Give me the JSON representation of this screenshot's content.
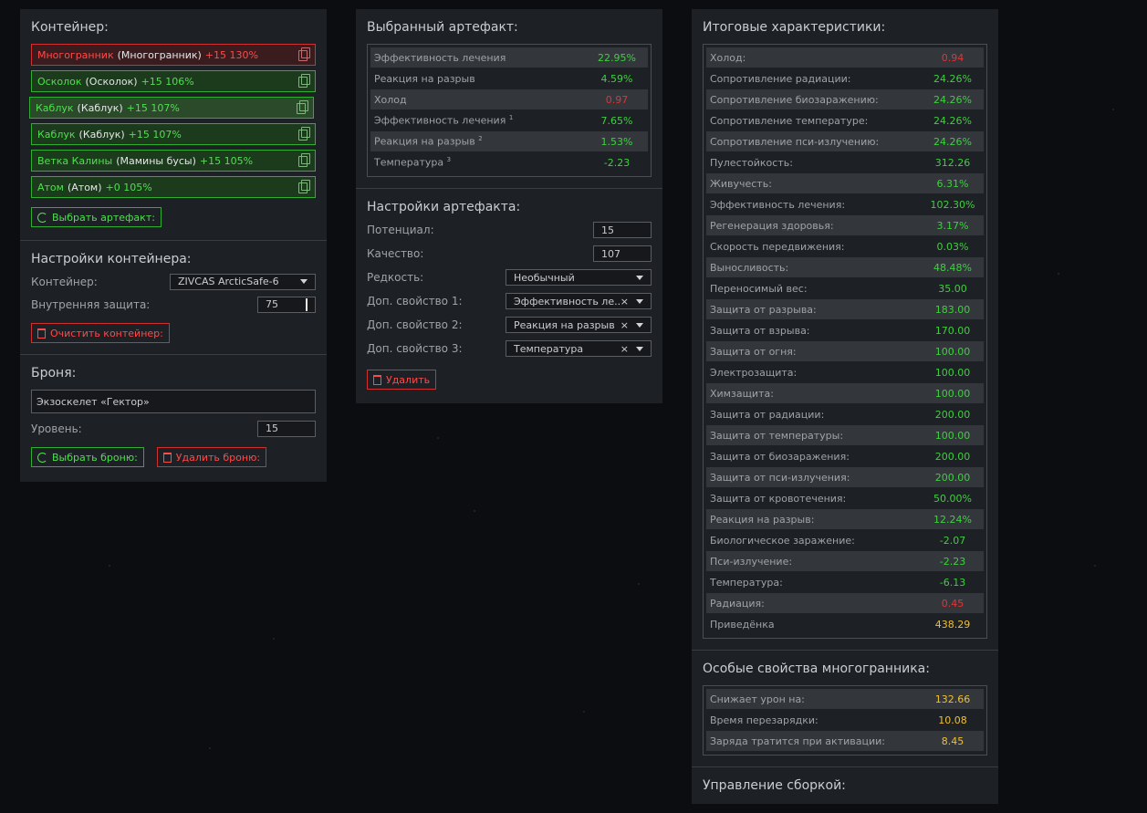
{
  "container_panel": {
    "title": "Контейнер:",
    "slots": [
      {
        "name": "Многогранник",
        "orig": "(Многогранник)",
        "level": "+15 130%",
        "status": "bad"
      },
      {
        "name": "Осколок",
        "orig": "(Осколок)",
        "level": "+15 106%",
        "status": "ok"
      },
      {
        "name": "Каблук",
        "orig": "(Каблук)",
        "level": "+15 107%",
        "status": "selected"
      },
      {
        "name": "Каблук",
        "orig": "(Каблук)",
        "level": "+15 107%",
        "status": "ok"
      },
      {
        "name": "Ветка Калины",
        "orig": "(Мамины бусы)",
        "level": "+15 105%",
        "status": "ok"
      },
      {
        "name": "Атом",
        "orig": "(Атом)",
        "level": "+0 105%",
        "status": "ok"
      }
    ],
    "select_button": "Выбрать артефакт:"
  },
  "container_settings": {
    "title": "Настройки контейнера:",
    "container_label": "Контейнер:",
    "container_value": "ZIVCAS ArcticSafe-6",
    "protection_label": "Внутренняя защита:",
    "protection_value": "75",
    "clear_button": "Очистить контейнер:"
  },
  "armor": {
    "title": "Броня:",
    "armor_value": "Экзоскелет «Гектор»",
    "level_label": "Уровень:",
    "level_value": "15",
    "select_button": "Выбрать броню:",
    "delete_button": "Удалить броню:"
  },
  "selected_artifact": {
    "title": "Выбранный артефакт:",
    "rows": [
      {
        "k": "Эффективность лечения",
        "sup": "",
        "v": "22.95%",
        "c": "g"
      },
      {
        "k": "Реакция на разрыв",
        "sup": "",
        "v": "4.59%",
        "c": "g"
      },
      {
        "k": "Холод",
        "sup": "",
        "v": "0.97",
        "c": "r"
      },
      {
        "k": "Эффективность лечения",
        "sup": "1",
        "v": "7.65%",
        "c": "g"
      },
      {
        "k": "Реакция на разрыв",
        "sup": "2",
        "v": "1.53%",
        "c": "g"
      },
      {
        "k": "Температура",
        "sup": "3",
        "v": "-2.23",
        "c": "g"
      }
    ]
  },
  "artifact_settings": {
    "title": "Настройки артефакта:",
    "potential_label": "Потенциал:",
    "potential_value": "15",
    "quality_label": "Качество:",
    "quality_value": "107",
    "rarity_label": "Редкость:",
    "rarity_value": "Необычный",
    "extra1_label": "Доп. свойство 1:",
    "extra1_value": "Эффективность ле...",
    "extra2_label": "Доп. свойство 2:",
    "extra2_value": "Реакция на разрыв",
    "extra3_label": "Доп. свойство 3:",
    "extra3_value": "Температура",
    "delete_button": "Удалить"
  },
  "totals": {
    "title": "Итоговые характеристики:",
    "rows": [
      {
        "k": "Холод:",
        "v": "0.94",
        "c": "r"
      },
      {
        "k": "Сопротивление радиации:",
        "v": "24.26%",
        "c": "g"
      },
      {
        "k": "Сопротивление биозаражению:",
        "v": "24.26%",
        "c": "g"
      },
      {
        "k": "Сопротивление температуре:",
        "v": "24.26%",
        "c": "g"
      },
      {
        "k": "Сопротивление пси-излучению:",
        "v": "24.26%",
        "c": "g"
      },
      {
        "k": "Пулестойкость:",
        "v": "312.26",
        "c": "g"
      },
      {
        "k": "Живучесть:",
        "v": "6.31%",
        "c": "g"
      },
      {
        "k": "Эффективность лечения:",
        "v": "102.30%",
        "c": "g"
      },
      {
        "k": "Регенерация здоровья:",
        "v": "3.17%",
        "c": "g"
      },
      {
        "k": "Скорость передвижения:",
        "v": "0.03%",
        "c": "g"
      },
      {
        "k": "Выносливость:",
        "v": "48.48%",
        "c": "g"
      },
      {
        "k": "Переносимый вес:",
        "v": "35.00",
        "c": "g"
      },
      {
        "k": "Защита от разрыва:",
        "v": "183.00",
        "c": "g"
      },
      {
        "k": "Защита от взрыва:",
        "v": "170.00",
        "c": "g"
      },
      {
        "k": "Защита от огня:",
        "v": "100.00",
        "c": "g"
      },
      {
        "k": "Электрозащита:",
        "v": "100.00",
        "c": "g"
      },
      {
        "k": "Химзащита:",
        "v": "100.00",
        "c": "g"
      },
      {
        "k": "Защита от радиации:",
        "v": "200.00",
        "c": "g"
      },
      {
        "k": "Защита от температуры:",
        "v": "100.00",
        "c": "g"
      },
      {
        "k": "Защита от биозаражения:",
        "v": "200.00",
        "c": "g"
      },
      {
        "k": "Защита от пси-излучения:",
        "v": "200.00",
        "c": "g"
      },
      {
        "k": "Защита от кровотечения:",
        "v": "50.00%",
        "c": "g"
      },
      {
        "k": "Реакция на разрыв:",
        "v": "12.24%",
        "c": "g"
      },
      {
        "k": "Биологическое заражение:",
        "v": "-2.07",
        "c": "g"
      },
      {
        "k": "Пси-излучение:",
        "v": "-2.23",
        "c": "g"
      },
      {
        "k": "Температура:",
        "v": "-6.13",
        "c": "g"
      },
      {
        "k": "Радиация:",
        "v": "0.45",
        "c": "r"
      },
      {
        "k": "Приведёнка",
        "v": "438.29",
        "c": "y"
      }
    ]
  },
  "special": {
    "title": "Особые свойства многогранника:",
    "rows": [
      {
        "k": "Снижает урон на:",
        "v": "132.66",
        "c": "y"
      },
      {
        "k": "Время перезарядки:",
        "v": "10.08",
        "c": "y"
      },
      {
        "k": "Заряда тратится при активации:",
        "v": "8.45",
        "c": "y"
      }
    ]
  },
  "build": {
    "title": "Управление сборкой:"
  },
  "colors": {
    "green": "#3fcf3f",
    "red": "#e03535",
    "yellow": "#f0c030",
    "panel": "#1d2024"
  }
}
